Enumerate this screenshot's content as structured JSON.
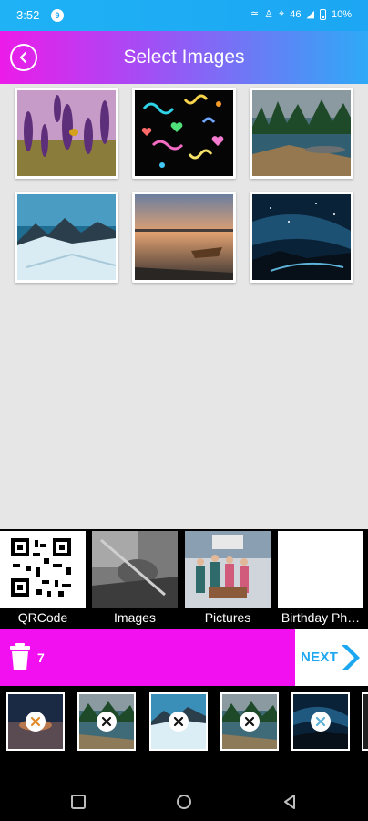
{
  "status": {
    "time": "3:52",
    "badge": "9",
    "network": "46",
    "battery": "10%"
  },
  "app_bar": {
    "title": "Select Images"
  },
  "gallery": [
    {
      "name": "lavender-bee"
    },
    {
      "name": "confetti"
    },
    {
      "name": "lake-forest"
    },
    {
      "name": "snow-mountain"
    },
    {
      "name": "sunset-boat"
    },
    {
      "name": "night-sky"
    }
  ],
  "albums": [
    {
      "label": "QRCode"
    },
    {
      "label": "Images"
    },
    {
      "label": "Pictures"
    },
    {
      "label": "Birthday Ph…"
    }
  ],
  "action_bar": {
    "count": "7",
    "next_label": "NEXT"
  },
  "colors": {
    "accent_pink": "#f20ff0",
    "accent_blue": "#1ea7f1",
    "status_blue": "#1ca6f3"
  }
}
